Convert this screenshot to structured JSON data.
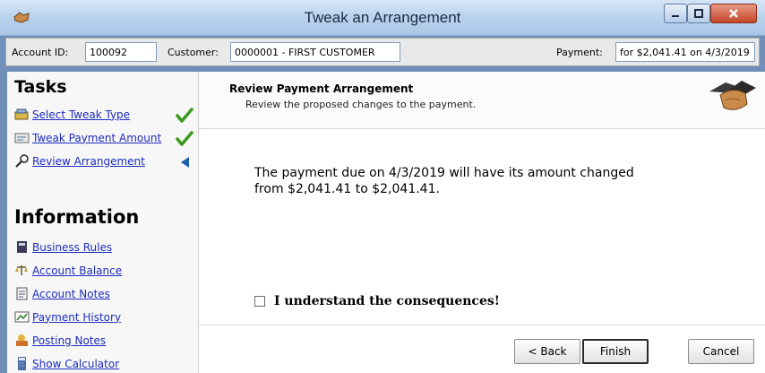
{
  "window": {
    "title": "Tweak an Arrangement",
    "icon": "app-icon"
  },
  "fields": {
    "account_label": "Account ID:",
    "account_value": "100092",
    "customer_label": "Customer:",
    "customer_value": "0000001 - FIRST CUSTOMER",
    "payment_label": "Payment:",
    "payment_value": "for $2,041.41 on 4/3/2019"
  },
  "tasks": {
    "heading": "Tasks",
    "items": [
      {
        "label": "Select Tweak Type",
        "icon": "wizard-icon",
        "status": "done"
      },
      {
        "label": "Tweak Payment Amount",
        "icon": "edit-icon",
        "status": "done"
      },
      {
        "label": "Review Arrangement",
        "icon": "magnifier-icon",
        "status": "current"
      }
    ]
  },
  "information": {
    "heading": "Information",
    "items": [
      {
        "label": "Business Rules",
        "icon": "book-icon"
      },
      {
        "label": "Account Balance",
        "icon": "balance-icon"
      },
      {
        "label": "Account Notes",
        "icon": "notes-icon"
      },
      {
        "label": "Payment History",
        "icon": "history-icon"
      },
      {
        "label": "Posting Notes",
        "icon": "posting-notes-icon"
      },
      {
        "label": "Show Calculator",
        "icon": "calculator-icon"
      }
    ]
  },
  "main": {
    "title": "Review Payment Arrangement",
    "subtitle": "Review the proposed changes to the payment.",
    "message_line1": "The payment due on 4/3/2019 will have its amount changed",
    "message_line2": "from $2,041.41 to $2,041.41.",
    "consent_label": "I understand the consequences!",
    "consent_checked": false
  },
  "buttons": {
    "back": "< Back",
    "finish": "Finish",
    "cancel": "Cancel"
  },
  "colors": {
    "link": "#1d2cbe",
    "check": "#3a9a1e",
    "current_marker": "#1e5fa8"
  }
}
